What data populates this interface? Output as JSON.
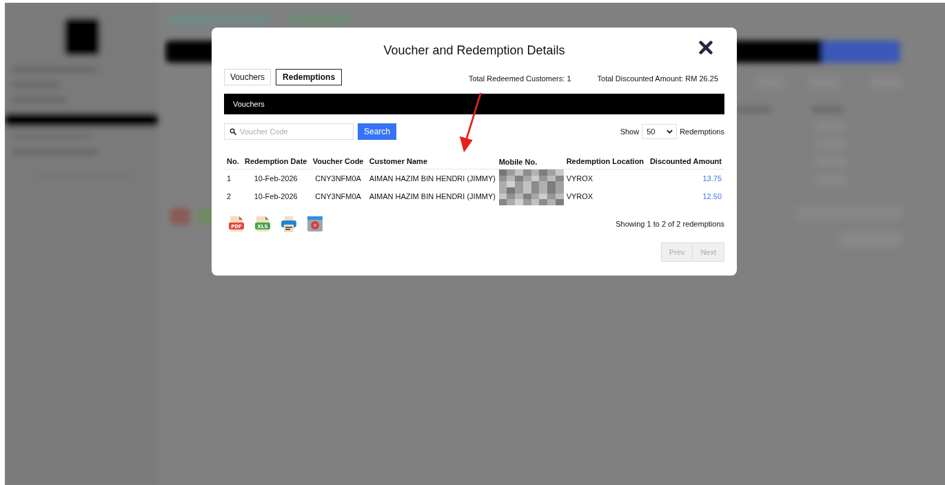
{
  "modal": {
    "title": "Voucher and Redemption Details",
    "tabs": [
      {
        "label": "Vouchers",
        "selected": false
      },
      {
        "label": "Redemptions",
        "selected": true
      }
    ],
    "stats": [
      "Total Redeemed Customers: 1",
      "Total Discounted Amount: RM 26.25"
    ],
    "section_bar": "Vouchers",
    "search": {
      "placeholder": "Voucher Code",
      "button": "Search"
    },
    "page_size": {
      "prefix": "Show",
      "value": "50",
      "suffix": "Redemptions"
    },
    "table": {
      "columns": [
        "No.",
        "Redemption Date",
        "Voucher Code",
        "Customer Name",
        "Mobile No.",
        "Redemption Location",
        "Discounted Amount"
      ],
      "rows": [
        {
          "no": "1",
          "date": "10-Feb-2026",
          "code": "CNY3NFM0A",
          "customer": "AIMAN HAZIM BIN HENDRI (JIMMY)",
          "location": "VYROX",
          "amount": "13.75"
        },
        {
          "no": "2",
          "date": "10-Feb-2026",
          "code": "CNY3NFM0A",
          "customer": "AIMAN HAZIM BIN HENDRI (JIMMY)",
          "location": "VYROX",
          "amount": "12.50"
        }
      ]
    },
    "exports": [
      {
        "kind": "pdf",
        "label": "PDF"
      },
      {
        "kind": "xls",
        "label": "XLS"
      },
      {
        "kind": "print"
      },
      {
        "kind": "settings"
      }
    ],
    "summary": "Showing 1 to 2 of 2 redemptions",
    "pagination": [
      {
        "label": "Prev",
        "disabled": true
      },
      {
        "label": "Next",
        "disabled": true
      }
    ]
  }
}
